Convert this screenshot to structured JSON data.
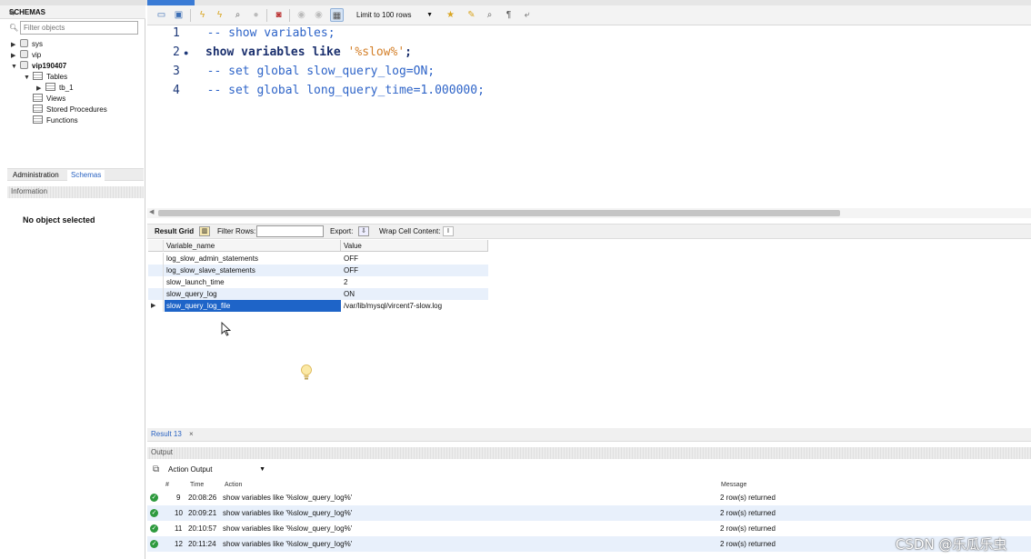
{
  "navigator": {
    "header": "SCHEMAS",
    "filter_placeholder": "Filter objects",
    "tree": {
      "sys": "sys",
      "vip": "vip",
      "db": "vip190407",
      "tables": "Tables",
      "table1": "tb_1",
      "views": "Views",
      "procs": "Stored Procedures",
      "functions": "Functions"
    },
    "tabs": {
      "admin": "Administration",
      "schemas": "Schemas"
    },
    "info_header": "Information",
    "no_object": "No object selected"
  },
  "toolbar": {
    "limit": "Limit to 100 rows"
  },
  "editor": {
    "lines": [
      {
        "num": "1",
        "text": "  -- show variables;",
        "kind": "comment"
      },
      {
        "num": "2",
        "kw": "show variables like ",
        "str": "'%slow%'",
        "tail": ";",
        "kind": "statement"
      },
      {
        "num": "3",
        "text": "  -- set global slow_query_log=ON;",
        "kind": "comment"
      },
      {
        "num": "4",
        "text": "  -- set global long_query_time=1.000000;",
        "kind": "comment"
      }
    ]
  },
  "result_toolbar": {
    "result_grid": "Result Grid",
    "filter_rows": "Filter Rows:",
    "export": "Export:",
    "wrap": "Wrap Cell Content:"
  },
  "grid": {
    "columns": [
      "Variable_name",
      "Value"
    ],
    "rows": [
      [
        "log_slow_admin_statements",
        "OFF"
      ],
      [
        "log_slow_slave_statements",
        "OFF"
      ],
      [
        "slow_launch_time",
        "2"
      ],
      [
        "slow_query_log",
        "ON"
      ],
      [
        "slow_query_log_file",
        "/var/lib/mysql/vircent7-slow.log"
      ]
    ]
  },
  "result_tab": {
    "label": "Result 13",
    "close": "×"
  },
  "output": {
    "header": "Output",
    "selector": "Action Output",
    "columns": {
      "num": "#",
      "time": "Time",
      "action": "Action",
      "message": "Message"
    },
    "rows": [
      {
        "num": "9",
        "time": "20:08:26",
        "action": "show variables like '%slow_query_log%'",
        "message": "2 row(s) returned"
      },
      {
        "num": "10",
        "time": "20:09:21",
        "action": "show variables like '%slow_query_log%'",
        "message": "2 row(s) returned"
      },
      {
        "num": "11",
        "time": "20:10:57",
        "action": "show variables like '%slow_query_log%'",
        "message": "2 row(s) returned"
      },
      {
        "num": "12",
        "time": "20:11:24",
        "action": "show variables like '%slow_query_log%'",
        "message": "2 row(s) returned"
      }
    ]
  },
  "watermark": "CSDN @乐瓜乐虫",
  "colors": {
    "accent": "#1e64c8",
    "ok": "#2e9a3e",
    "comment": "#2e64c8",
    "string": "#d4802a"
  }
}
